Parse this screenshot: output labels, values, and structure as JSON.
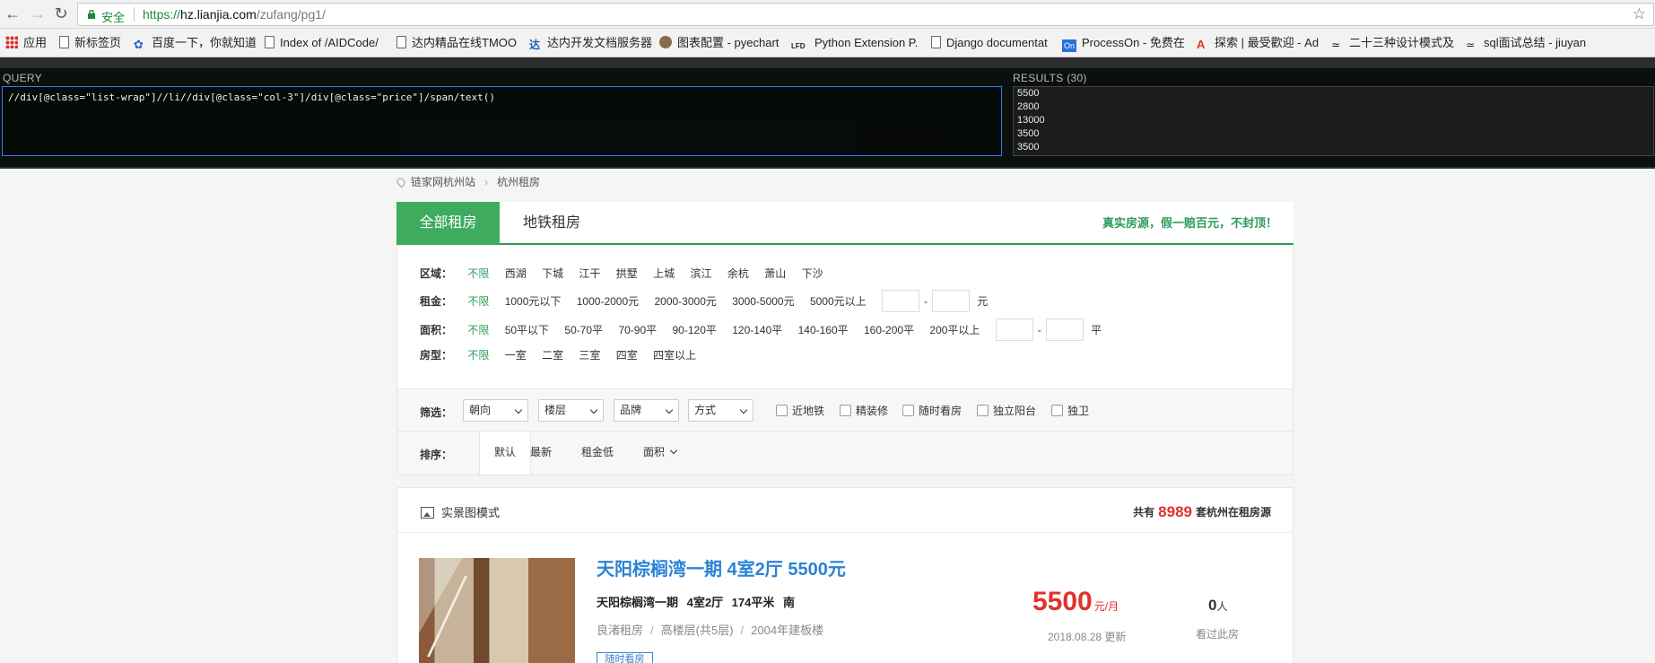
{
  "browser": {
    "secure_label": "安全",
    "url_scheme": "https://",
    "url_host": "hz.lianjia.com",
    "url_path": "/zufang/pg1/",
    "bookmarks": [
      "应用",
      "新标签页",
      "百度一下，你就知道",
      "Index of /AIDCode/",
      "达内精品在线TMOO",
      "达内开发文档服务器",
      "图表配置 - pyechart",
      "Python Extension P.",
      "Django documentat",
      "ProcessOn - 免费在",
      "探索 | 最受歡迎 - Ad",
      "二十三种设计模式及",
      "sql面试总结 - jiuyan"
    ]
  },
  "xpath": {
    "query_label": "QUERY",
    "results_label": "RESULTS (30)",
    "query": "//div[@class=\"list-wrap\"]//li//div[@class=\"col-3\"]/div[@class=\"price\"]/span/text()",
    "results": [
      "5500",
      "2800",
      "13000",
      "3500",
      "3500"
    ]
  },
  "breadcrumb": {
    "home": "链家网杭州站",
    "current": "杭州租房"
  },
  "tabs": {
    "active": "全部租房",
    "other": "地铁租房",
    "promo": "真实房源，假一赔百元，不封顶！"
  },
  "filters": {
    "area_label": "区域：",
    "area_options": [
      "不限",
      "西湖",
      "下城",
      "江干",
      "拱墅",
      "上城",
      "滨江",
      "余杭",
      "萧山",
      "下沙"
    ],
    "rent_label": "租金：",
    "rent_options": [
      "不限",
      "1000元以下",
      "1000-2000元",
      "2000-3000元",
      "3000-5000元",
      "5000元以上"
    ],
    "rent_unit": "元",
    "size_label": "面积：",
    "size_options": [
      "不限",
      "50平以下",
      "50-70平",
      "70-90平",
      "90-120平",
      "120-140平",
      "140-160平",
      "160-200平",
      "200平以上"
    ],
    "size_unit": "平",
    "room_label": "房型：",
    "room_options": [
      "不限",
      "一室",
      "二室",
      "三室",
      "四室",
      "四室以上"
    ],
    "range_dash": "-"
  },
  "screen": {
    "label": "筛选：",
    "selects": [
      "朝向",
      "楼层",
      "品牌",
      "方式"
    ],
    "checkboxes": [
      "近地铁",
      "精装修",
      "随时看房",
      "独立阳台",
      "独卫"
    ]
  },
  "sort": {
    "label": "排序：",
    "options": [
      "默认",
      "最新",
      "租金低",
      "面积"
    ]
  },
  "list": {
    "pic_mode": "实景图模式",
    "total_prefix": "共有",
    "total_count": "8989",
    "total_suffix": "套杭州在租房源",
    "item": {
      "title": "天阳棕榈湾一期 4室2厅 5500元",
      "meta": "天阳棕榈湾一期 4室2厅 174平米 南",
      "district": "良渚租房",
      "floor": "高楼层(共5层)",
      "year": "2004年建板楼",
      "tag": "随时看房",
      "price": "5500",
      "price_unit": "元/月",
      "updated": "2018.08.28 更新",
      "views": "0",
      "views_unit": "人",
      "views_label": "看过此房"
    }
  },
  "colors": {
    "accent_green": "#3eab5f",
    "price_red": "#e0322c",
    "title_blue": "#2a82d6"
  }
}
